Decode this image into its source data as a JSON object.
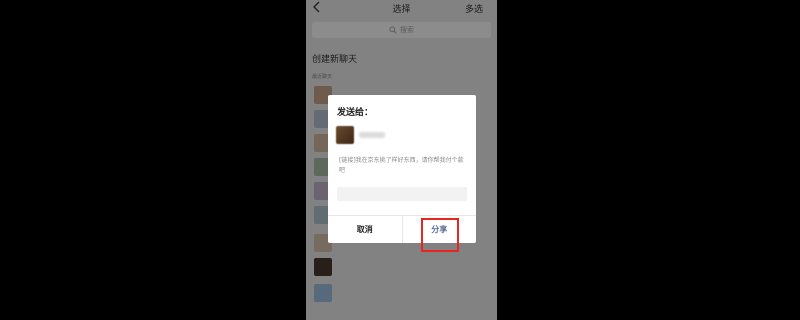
{
  "navbar": {
    "title": "选择",
    "multi_select": "多选"
  },
  "search": {
    "placeholder": "搜索"
  },
  "new_chat": "创建新聊天",
  "section_label": "最近聊天",
  "dialog": {
    "title": "发送给：",
    "message": "[链接]我在京东挑了样好东西，请你帮我付个款吧",
    "cancel": "取消",
    "share": "分享"
  },
  "colors": {
    "highlight": "#e8261f",
    "share_text": "#576b95"
  }
}
